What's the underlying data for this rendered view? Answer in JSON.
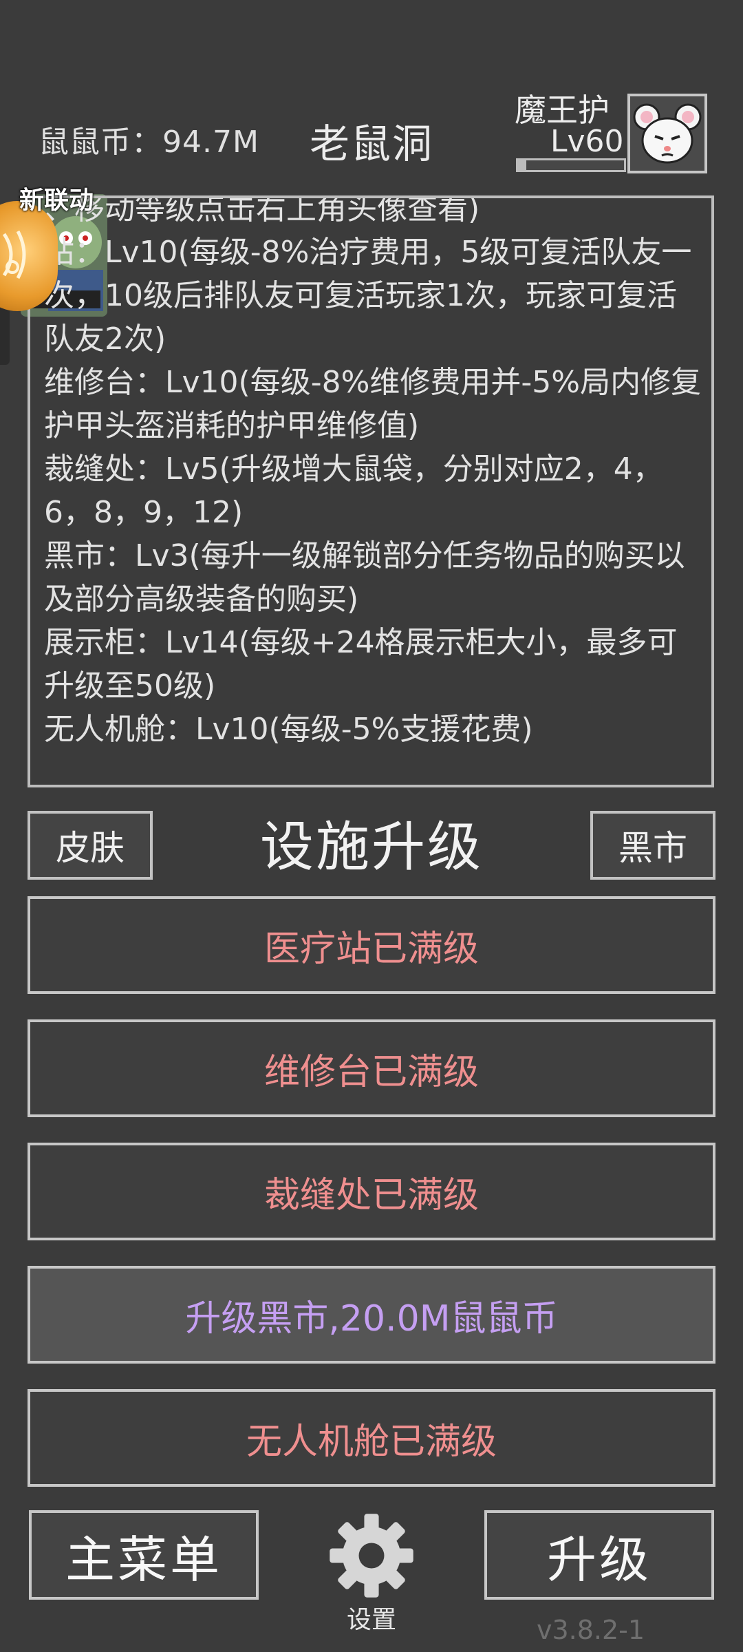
{
  "header": {
    "coins": "鼠鼠币：94.7M",
    "title": "老鼠洞",
    "player_name": "魔王护",
    "player_level": "Lv60",
    "xp_progress": 0.08
  },
  "event": {
    "label": "新联动"
  },
  "info": {
    "text": "、移动等级点击右上角头像查看)\n站：Lv10(每级-8%治疗费用，5级可复活队友一次，10级后排队友可复活玩家1次，玩家可复活队友2次)\n维修台：Lv10(每级-8%维修费用并-5%局内修复护甲头盔消耗的护甲维修值)\n裁缝处：Lv5(升级增大鼠袋，分别对应2，4，6，8，9，12)\n黑市：Lv3(每升一级解锁部分任务物品的购买以及部分高级装备的购买)\n展示柜：Lv14(每级+24格展示柜大小，最多可升级至50级)\n无人机舱：Lv10(每级-5%支援花费)"
  },
  "section": {
    "title": "设施升级",
    "skin_label": "皮肤",
    "black_market_label": "黑市"
  },
  "upgrades": [
    {
      "label": "医疗站已满级"
    },
    {
      "label": "维修台已满级"
    },
    {
      "label": "裁缝处已满级"
    },
    {
      "label": "升级黑市,20.0M鼠鼠币"
    },
    {
      "label": "无人机舱已满级"
    }
  ],
  "bottom": {
    "main_menu_label": "主菜单",
    "settings_label": "设置",
    "upgrade_label": "升级",
    "version": "v3.8.2-1"
  },
  "colors": {
    "background": "#3b3b3b",
    "maxed_text": "#ef8f8f",
    "upgradable_text": "#c59ff2",
    "border": "#c7c7c7"
  }
}
